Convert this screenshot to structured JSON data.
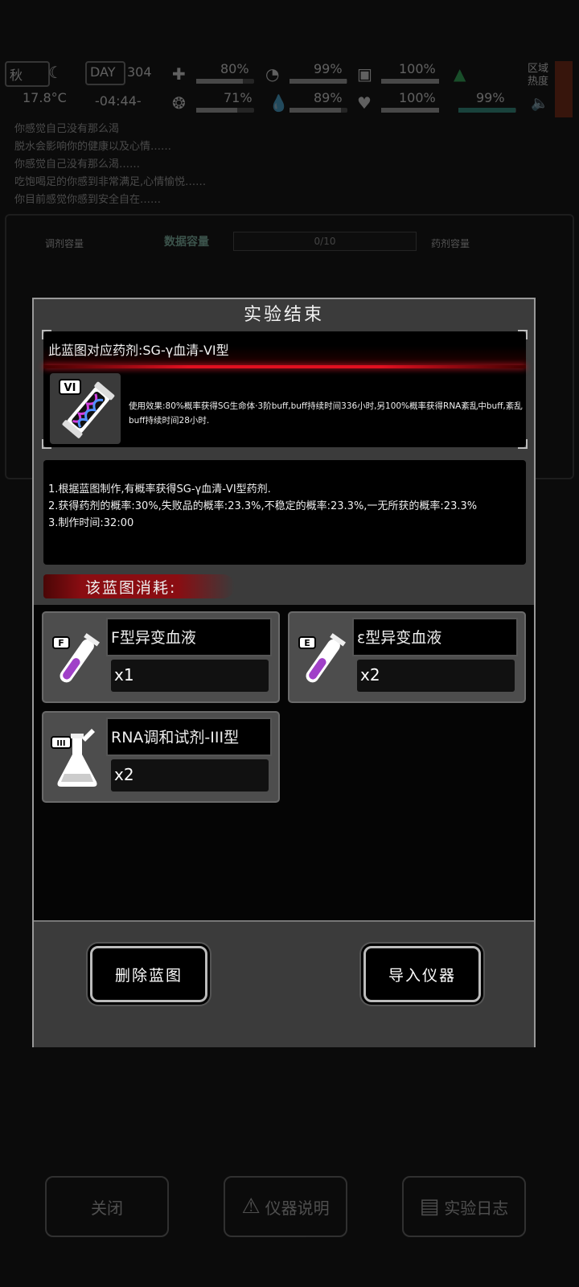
{
  "hud": {
    "season": "秋",
    "temperature": "17.8°C",
    "day_label": "DAY",
    "day_number": "304",
    "time": "-04:44-",
    "stats": [
      {
        "name": "health",
        "value": "80%"
      },
      {
        "name": "stomach",
        "value": "99%"
      },
      {
        "name": "stamina",
        "value": "100%"
      },
      {
        "name": "mood",
        "value": "71%"
      },
      {
        "name": "water",
        "value": "89%"
      },
      {
        "name": "heart",
        "value": "100%"
      },
      {
        "name": "energy",
        "value": "99%"
      }
    ],
    "region_heat_label": "区域热度"
  },
  "messages": [
    "你感觉自己没有那么渴",
    "脱水会影响你的健康以及心情……",
    "你感觉自己没有那么渴……",
    "吃饱喝足的你感到非常满足,心情愉悦……",
    "你目前感觉你感到安全自在……"
  ],
  "background_panel": {
    "left_label": "调剂容量",
    "title": "数据容量",
    "capacity": "0/10",
    "right_label": "药剂容量"
  },
  "dialog": {
    "title": "实验结束",
    "blueprint": {
      "header": "此蓝图对应药剂:SG-γ血清-VI型",
      "badge": "VI",
      "description": "使用效果:80%概率获得SG生命体·3阶buff,buff持续时间336小时,另100%概率获得RNA紊乱中buff,紊乱buff持续时间28小时."
    },
    "info_lines": [
      "1.根据蓝图制作,有概率获得SG-γ血清-VI型药剂.",
      "2.获得药剂的概率:30%,失败品的概率:23.3%,不稳定的概率:23.3%,一无所获的概率:23.3%",
      "3.制作时间:32:00"
    ],
    "consume_label": "该蓝图消耗:",
    "materials": [
      {
        "name": "F型异变血液",
        "qty": "x1",
        "badge": "F",
        "icon": "test-tube-icon"
      },
      {
        "name": "ε型异变血液",
        "qty": "x2",
        "badge": "Ε",
        "icon": "test-tube-icon"
      },
      {
        "name": "RNA调和试剂-III型",
        "qty": "x2",
        "badge": "III",
        "icon": "flask-icon"
      }
    ],
    "buttons": {
      "delete": "删除蓝图",
      "import": "导入仪器"
    }
  },
  "bottom_bar": {
    "close": "关闭",
    "instrument_info": "仪器说明",
    "experiment_log": "实验日志"
  },
  "colors": {
    "accent_red": "#e01020",
    "potion_purple": "#a040c8"
  }
}
